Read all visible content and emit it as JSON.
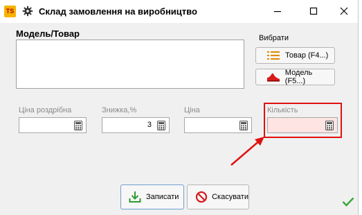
{
  "window": {
    "app_icon_text": "TS",
    "title": "Склад замовлення на виробництво",
    "minimize_icon": "minimize-icon",
    "maximize_icon": "maximize-icon",
    "close_icon": "close-icon"
  },
  "model_group": {
    "label": "Модель/Товар",
    "text_value": ""
  },
  "choose": {
    "label": "Вибрати",
    "product_button": "Товар (F4...)",
    "model_button": "Модель (F5...)",
    "product_icon": "list-icon",
    "model_icon": "shoe-icon"
  },
  "fields": {
    "retail_price": {
      "label": "Ціна роздрібна",
      "value": ""
    },
    "discount": {
      "label": "Знижка,%",
      "value": "3"
    },
    "price": {
      "label": "Ціна",
      "value": ""
    },
    "quantity": {
      "label": "Кількість",
      "value": ""
    }
  },
  "buttons": {
    "save": "Записати",
    "cancel": "Скасувати"
  },
  "colors": {
    "highlight": "#e01010",
    "quantity_bg": "#ffe4e4",
    "check": "#3aa63a"
  }
}
